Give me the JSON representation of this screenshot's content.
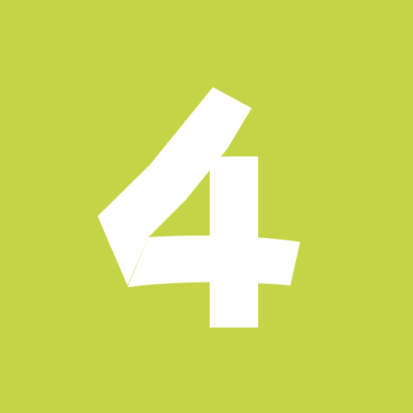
{
  "tile": {
    "background": "#c5d446",
    "glyph_color": "#ffffff",
    "glyph_text": "4"
  }
}
